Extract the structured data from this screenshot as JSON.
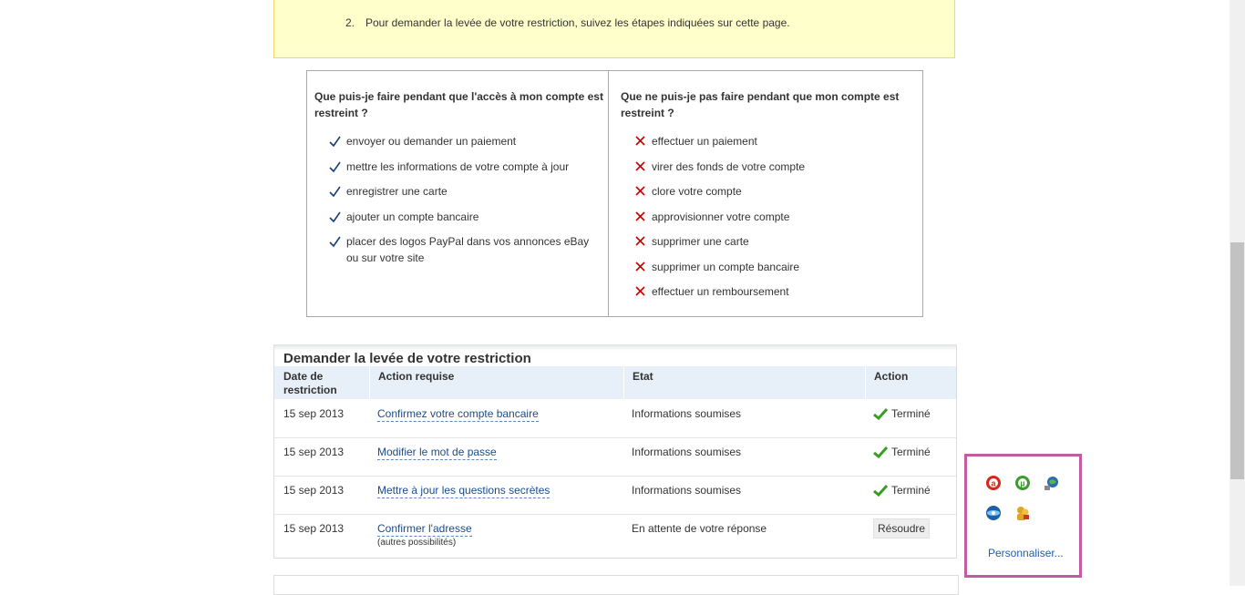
{
  "notice": {
    "step_number": "2.",
    "step_text": "Pour demander la levée de votre restriction, suivez les étapes indiquées sur cette page."
  },
  "can_do": {
    "title": "Que puis-je faire pendant que l'accès à mon compte est restreint ?",
    "items": [
      "envoyer ou demander un paiement",
      "mettre les informations de votre compte à jour",
      "enregistrer une carte",
      "ajouter un compte bancaire",
      "placer des logos PayPal dans vos annonces eBay ou sur votre site"
    ]
  },
  "cannot_do": {
    "title": "Que ne puis-je pas faire pendant que mon compte est restreint ?",
    "items": [
      "effectuer un paiement",
      "virer des fonds de votre compte",
      "clore votre compte",
      "approvisionner votre compte",
      "supprimer une carte",
      "supprimer un compte bancaire",
      "effectuer un remboursement"
    ]
  },
  "restriction": {
    "title": "Demander la levée de votre restriction",
    "headers": {
      "date": "Date de restriction",
      "action_required": "Action requise",
      "status": "Etat",
      "action": "Action"
    },
    "rows": [
      {
        "date": "15 sep 2013",
        "action": "Confirmez votre compte bancaire",
        "status": "Informations soumises",
        "result": "Terminé"
      },
      {
        "date": "15 sep 2013",
        "action": "Modifier le mot de passe",
        "status": "Informations soumises",
        "result": "Terminé"
      },
      {
        "date": "15 sep 2013",
        "action": "Mettre à jour les questions secrètes",
        "status": "Informations soumises",
        "result": "Terminé"
      },
      {
        "date": "15 sep 2013",
        "action": "Confirmer l'adresse",
        "sub": "(autres possibilités)",
        "status": "En attente de votre réponse",
        "button": "Résoudre"
      }
    ]
  },
  "tray": {
    "icons": [
      "adobe-reader-icon",
      "utorrent-icon",
      "network-globe-icon",
      "browser-sync-icon",
      "users-key-icon"
    ],
    "customize_label": "Personnaliser..."
  },
  "colors": {
    "notice_bg": "#ffffcc",
    "check": "#1a3f73",
    "cross": "#cc0000",
    "link": "#1a4c8c",
    "tray_border": "#c45ba0"
  }
}
